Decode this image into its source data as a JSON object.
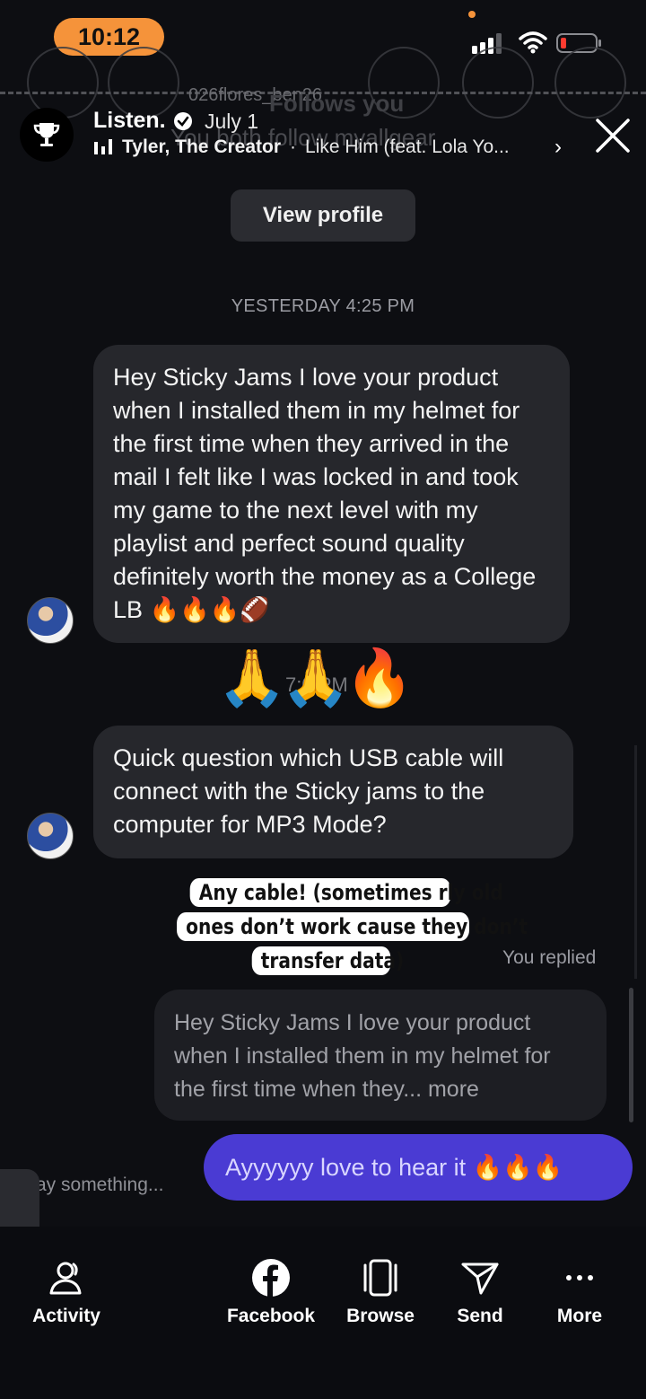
{
  "status_bar": {
    "time": "10:12"
  },
  "overlay": {
    "ghost_handle": "026flores_ben26",
    "ghost_follows": "Follows you",
    "ghost_both_follow": "You both follow myallgear"
  },
  "story": {
    "title": "Listen.",
    "date": "July 1",
    "artist": "Tyler, The Creator",
    "separator": "·",
    "song": "Like Him (feat. Lola Yo..."
  },
  "view_profile_label": "View profile",
  "timestamp": "YESTERDAY 4:25 PM",
  "messages": [
    {
      "text": "Hey Sticky Jams I love your product when I installed them in my helmet for the first time when they arrived in the mail I felt like I was locked in and took my game to the next level with my playlist and perfect sound quality definitely worth the money as a College LB 🔥🔥🔥🏈"
    },
    {
      "text": "🙏🙏🔥"
    },
    {
      "text": "Quick question which USB cable will connect with the Sticky jams to the computer for MP3 Mode?"
    }
  ],
  "ghost_time": "7:0 PM",
  "sticker": {
    "line1": "Any cable! (sometimes rly old",
    "line2": "ones don’t work cause they don’t",
    "line3": "transfer data)"
  },
  "you_replied": "You replied",
  "reply_quote": "Hey Sticky Jams I love your product when I installed them in my helmet for the first time when they... more",
  "outgoing": "Ayyyyyy love to hear it 🔥🔥🔥",
  "input_placeholder": "ay something...",
  "side_tab_glyph": "❭",
  "nav": [
    {
      "label": "Activity",
      "icon": "activity-icon"
    },
    {
      "label": "Facebook",
      "icon": "facebook-icon"
    },
    {
      "label": "Browse",
      "icon": "browse-icon"
    },
    {
      "label": "Send",
      "icon": "send-icon"
    },
    {
      "label": "More",
      "icon": "more-icon"
    }
  ],
  "colors": {
    "accent_orange": "#f5933a",
    "outgoing_bubble": "#4a3bd3",
    "incoming_bubble": "#26272c",
    "background": "#0d0e12"
  }
}
